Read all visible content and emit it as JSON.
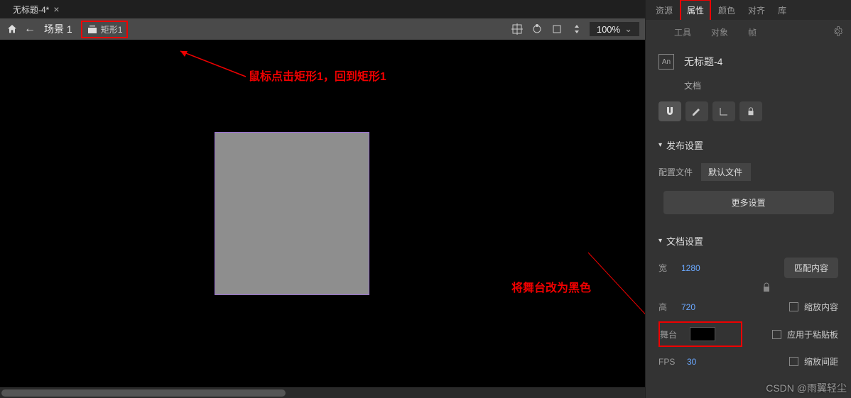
{
  "tab": {
    "title": "无标题-4*",
    "close": "×"
  },
  "breadcrumb": {
    "home_icon": "home-icon",
    "back": "←",
    "scene": "场景 1",
    "rect": "矩形1"
  },
  "stage_tools": {
    "zoom": "100%"
  },
  "annotations": {
    "click_rect": "鼠标点击矩形1，回到矩形1",
    "stage_black": "将舞台改为黑色"
  },
  "panel_tabs": {
    "resource": "资源",
    "properties": "属性",
    "color": "颜色",
    "align": "对齐",
    "library": "库"
  },
  "sub_tabs": {
    "tool": "工具",
    "object": "对象",
    "frame": "帧"
  },
  "doc": {
    "icon_label": "An",
    "title": "无标题-4",
    "subtitle": "文档"
  },
  "publish": {
    "title": "发布设置",
    "profile_label": "配置文件",
    "profile_value": "默认文件",
    "more": "更多设置"
  },
  "docset": {
    "title": "文档设置",
    "w_label": "宽",
    "w_value": "1280",
    "h_label": "高",
    "h_value": "720",
    "match": "匹配内容",
    "stage_label": "舞台",
    "fps_label": "FPS",
    "fps_value": "30",
    "scale_content": "缩放内容",
    "apply_paste": "应用于粘贴板",
    "scale_gap": "缩放间距"
  },
  "watermark": "CSDN @雨翼轻尘"
}
